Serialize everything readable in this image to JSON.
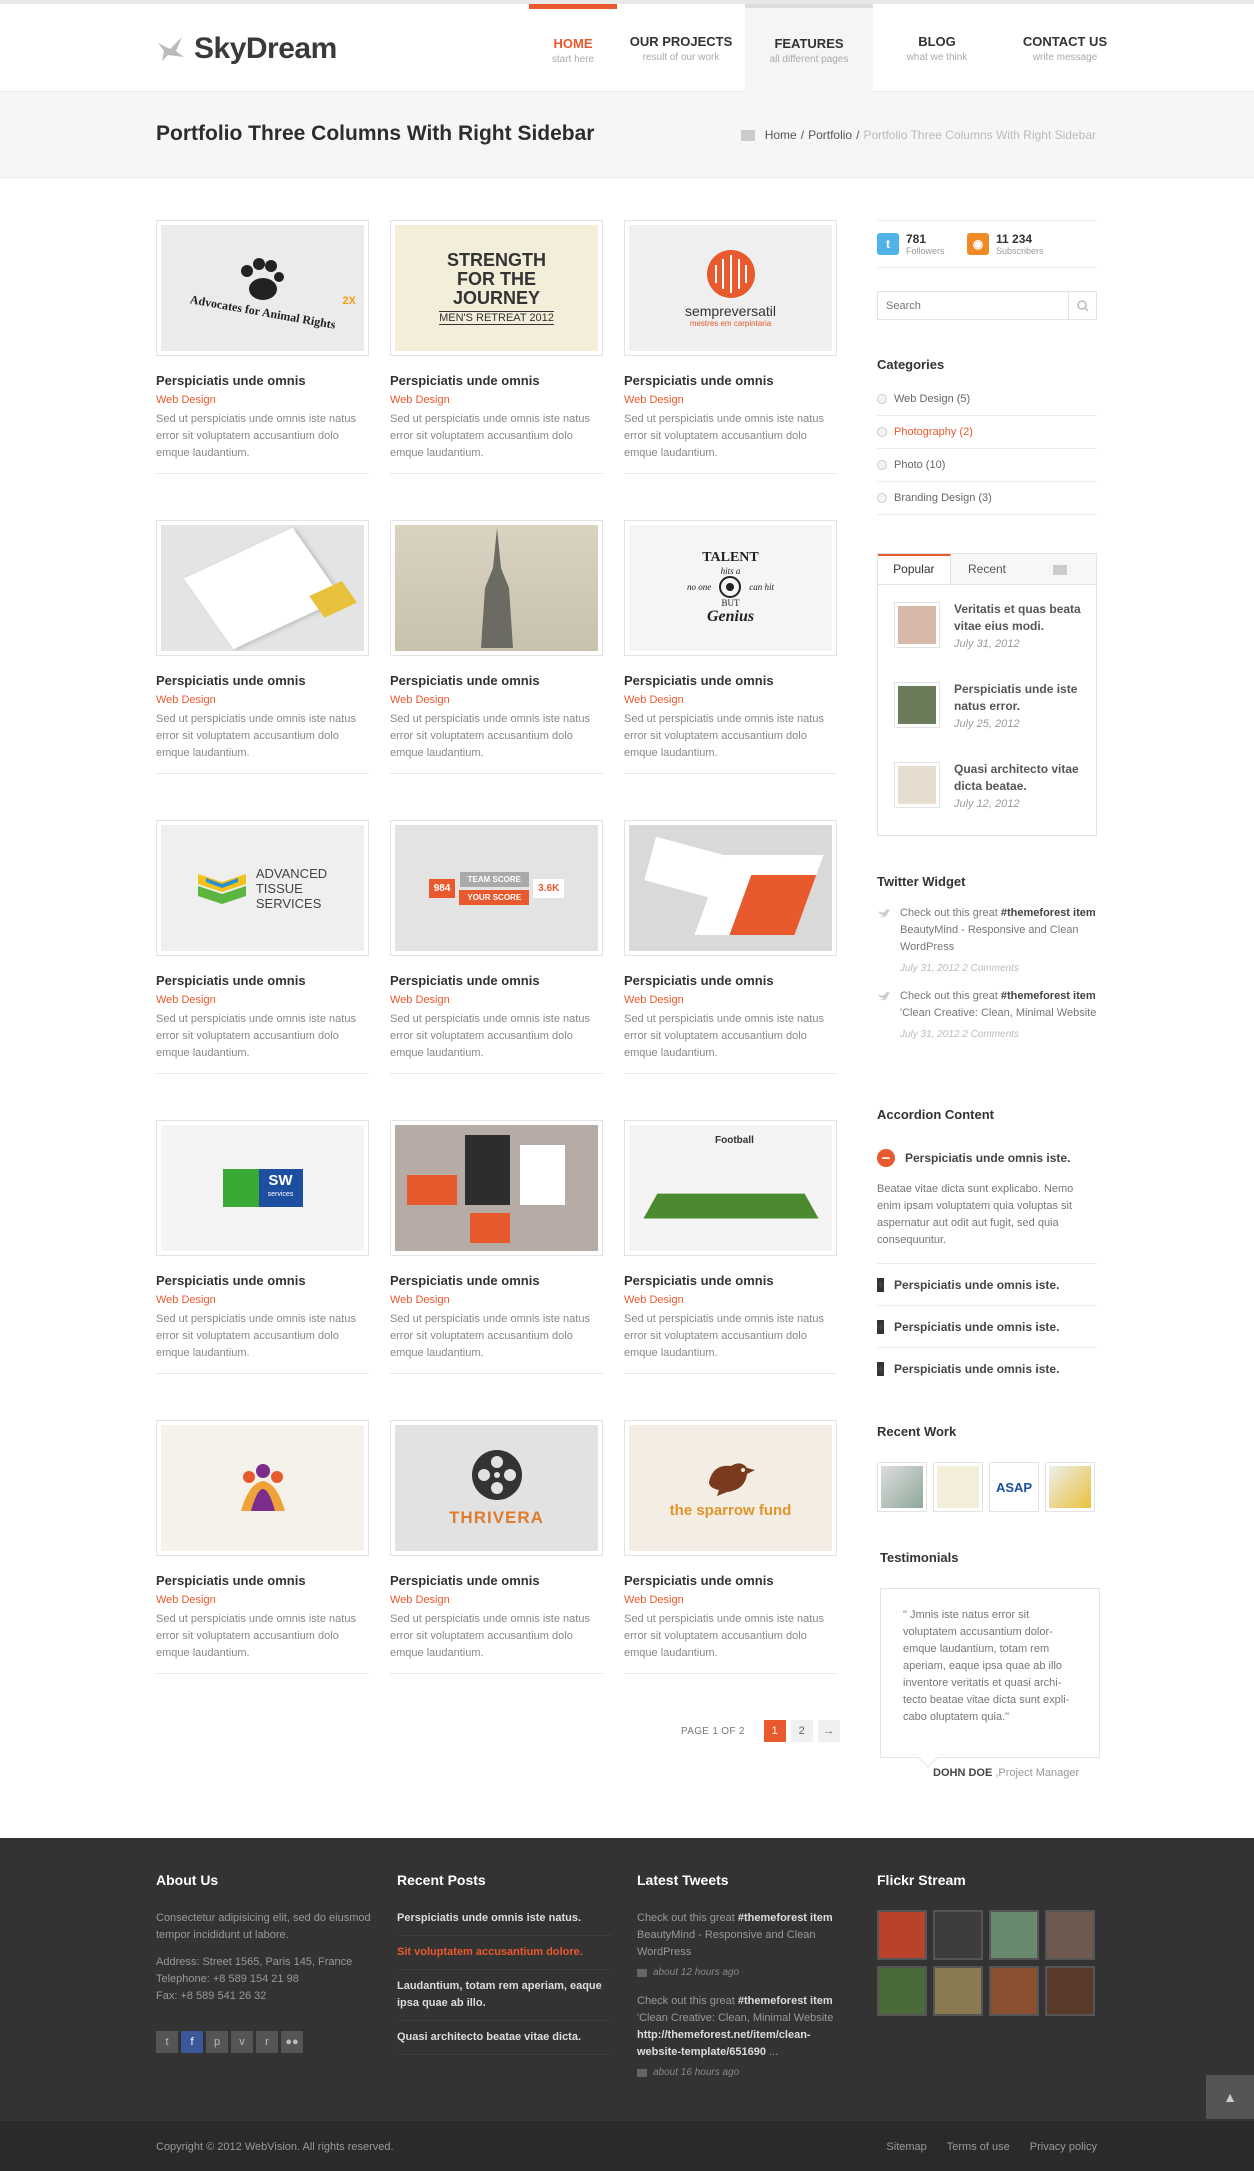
{
  "brand": {
    "name": "SkyDream"
  },
  "nav": [
    {
      "label": "HOME",
      "sub": "start here"
    },
    {
      "label": "OUR PROJECTS",
      "sub": "result of our work"
    },
    {
      "label": "FEATURES",
      "sub": "all different pages"
    },
    {
      "label": "BLOG",
      "sub": "what we think"
    },
    {
      "label": "CONTACT US",
      "sub": "write message"
    }
  ],
  "page": {
    "title": "Portfolio Three Columns With Right Sidebar"
  },
  "breadcrumb": {
    "home": "Home",
    "sep1": "/",
    "portfolio": "Portfolio",
    "sep2": "/",
    "current": "Portfolio Three Columns With Right Sidebar"
  },
  "portfolio": {
    "title": "Perspiciatis unde omnis",
    "category": "Web Design",
    "desc": "Sed ut perspiciatis unde omnis iste natus error sit voluptatem accusantium dolo emque laudantium.",
    "images": {
      "i1": "Advocates for Animal Rights",
      "i1b": "2X",
      "i2": "STRENGTH FOR THE JOURNEY",
      "i2b": "MEN'S RETREAT 2012",
      "i3": "sempreversatil",
      "i3b": "mestres em carpintaria",
      "i6a": "TALENT",
      "i6b": "hits a",
      "i6c": "no one",
      "i6d": "can hit",
      "i6e": "BUT",
      "i6f": "Genius",
      "i7": "ADVANCED",
      "i7b": "TISSUE",
      "i7c": "SERVICES",
      "i8a": "984",
      "i8b": "TEAM SCORE",
      "i8c": "3.6K",
      "i8d": "YOUR SCORE",
      "i10": "SW",
      "i10b": "services",
      "i12": "Football",
      "i14": "THRIVERA",
      "i15": "the sparrow fund"
    }
  },
  "pagination": {
    "label": "PAGE 1 OF 2",
    "pages": [
      "1",
      "2"
    ],
    "next": "→"
  },
  "social": {
    "twitter_count": "781",
    "twitter_label": "Followers",
    "rss_count": "11 234",
    "rss_label": "Subscribers"
  },
  "search": {
    "placeholder": "Search"
  },
  "categories": {
    "title": "Categories",
    "items": [
      "Web Design (5)",
      "Photography (2)",
      "Photo (10)",
      "Branding Design (3)"
    ]
  },
  "tabs": {
    "popular": "Popular",
    "recent": "Recent",
    "posts": [
      {
        "title": "Veritatis et quas beata vitae eius modi.",
        "date": "July 31, 2012"
      },
      {
        "title": "Perspiciatis unde iste natus error.",
        "date": "July 25, 2012"
      },
      {
        "title": "Quasi architecto vitae dicta beatae.",
        "date": "July 12, 2012"
      }
    ]
  },
  "twitter": {
    "title": "Twitter Widget",
    "tweets": [
      {
        "pre": "Check out this great ",
        "tag": "#themeforest item",
        "post": " BeautyMind - Responsive and Clean WordPress",
        "meta": "July 31, 2012 2 Comments"
      },
      {
        "pre": "Check out this great ",
        "tag": "#themeforest item",
        "post": " 'Clean Creative: Clean, Minimal Website",
        "meta": "July 31, 2012 2 Comments"
      }
    ]
  },
  "accordion": {
    "title": "Accordion Content",
    "open": "Perspiciatis unde omnis iste.",
    "body": "Beatae vitae dicta sunt explicabo. Nemo enim ipsam voluptatem quia voluptas sit aspernatur aut odit aut fugit, sed quia consequuntur.",
    "closed": [
      "Perspiciatis unde omnis iste.",
      "Perspiciatis unde omnis iste.",
      "Perspiciatis unde omnis iste."
    ],
    "open_symbol": "−",
    "closed_symbol": "+"
  },
  "recent_work": {
    "title": "Recent Work",
    "asap": "ASAP"
  },
  "testimonials": {
    "title": "Testimonials",
    "quote": "\" Jmnis iste natus error sit voluptatem accusantium dolor-emque laudantium, totam rem aperiam, eaque ipsa quae ab illo inventore veritatis et quasi archi-tecto beatae vitae dicta sunt expli-cabo oluptatem quia.\"",
    "author": "DOHN DOE",
    "role": ",Project Manager"
  },
  "footer": {
    "about": {
      "title": "About Us",
      "text": "Consectetur adipisicing elit, sed do eiusmod tempor incididunt ut labore.",
      "address": "Address: Street 1565, Paris 145, France",
      "phone": "Telephone: +8 589 154 21 98",
      "fax": "Fax: +8 589 541 26 32"
    },
    "social_icons": [
      "t",
      "f",
      "p",
      "v",
      "r",
      "●●"
    ],
    "recent_posts": {
      "title": "Recent Posts",
      "items": [
        "Perspiciatis unde omnis iste natus.",
        "Sit voluptatem accusantium dolore.",
        "Laudantium, totam rem aperiam, eaque ipsa quae ab illo.",
        "Quasi architecto beatae vitae dicta."
      ]
    },
    "latest_tweets": {
      "title": "Latest Tweets",
      "items": [
        {
          "pre": "Check out this great ",
          "tag": "#themeforest item",
          "post": " BeautyMind - Responsive and Clean WordPress",
          "time": "about 12 hours ago"
        },
        {
          "pre": "Check out this great ",
          "tag": "#themeforest item",
          "post": " 'Clean Creative: Clean, Minimal Website ",
          "link": "http://themeforest.net/item/clean-website-template/651690",
          "ellipsis": " ...",
          "time": "about 16 hours ago"
        }
      ]
    },
    "flickr": {
      "title": "Flickr Stream"
    },
    "copyright": "Copyright © 2012 WebVision. All rights reserved.",
    "links": [
      "Sitemap",
      "Terms of use",
      "Privacy policy"
    ]
  },
  "colors": {
    "accent": "#e8592d",
    "footer": "#333333",
    "bottom": "#2a2a2a"
  }
}
